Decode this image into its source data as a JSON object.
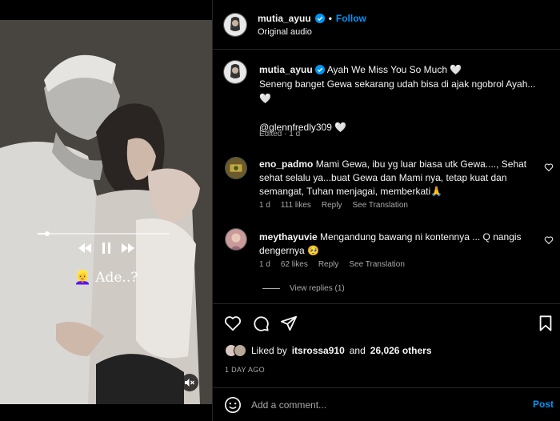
{
  "video": {
    "caption_text": "Ade..?",
    "caption_emoji": "👱‍♀️",
    "progress": 0.07
  },
  "header": {
    "username": "mutia_ayuu",
    "dot": "•",
    "follow_label": "Follow",
    "audio_label": "Original audio"
  },
  "caption": {
    "username": "mutia_ayuu",
    "line1": "Ayah We Miss You So Much 🤍",
    "line2": "Seneng banget Gewa sekarang udah bisa di ajak ngobrol Ayah... 🤍",
    "mention": "@glennfredly309 🤍",
    "edited": "Edited · 1 d"
  },
  "comments": [
    {
      "username": "eno_padmo",
      "text": "Mami Gewa, ibu yg luar biasa utk Gewa...., Sehat sehat selalu ya...buat Gewa dan Mami nya, tetap kuat dan semangat, Tuhan menjagai, memberkati🙏",
      "age": "1 d",
      "likes": "111 likes",
      "reply": "Reply",
      "translate": "See Translation"
    },
    {
      "username": "meythayuvie",
      "text": "Mengandung bawang ni kontennya ... Q nangis dengernya 🥺",
      "age": "1 d",
      "likes": "62 likes",
      "reply": "Reply",
      "translate": "See Translation"
    }
  ],
  "view_replies": "View replies (1)",
  "likes": {
    "prefix": "Liked by",
    "user": "itsrossa910",
    "and": "and",
    "others": "26,026 others"
  },
  "post_date": "1 DAY AGO",
  "add_comment": {
    "placeholder": "Add a comment...",
    "post_label": "Post"
  },
  "colors": {
    "accent": "#0095f6",
    "background": "#000000",
    "muted": "#a8a8a8"
  }
}
